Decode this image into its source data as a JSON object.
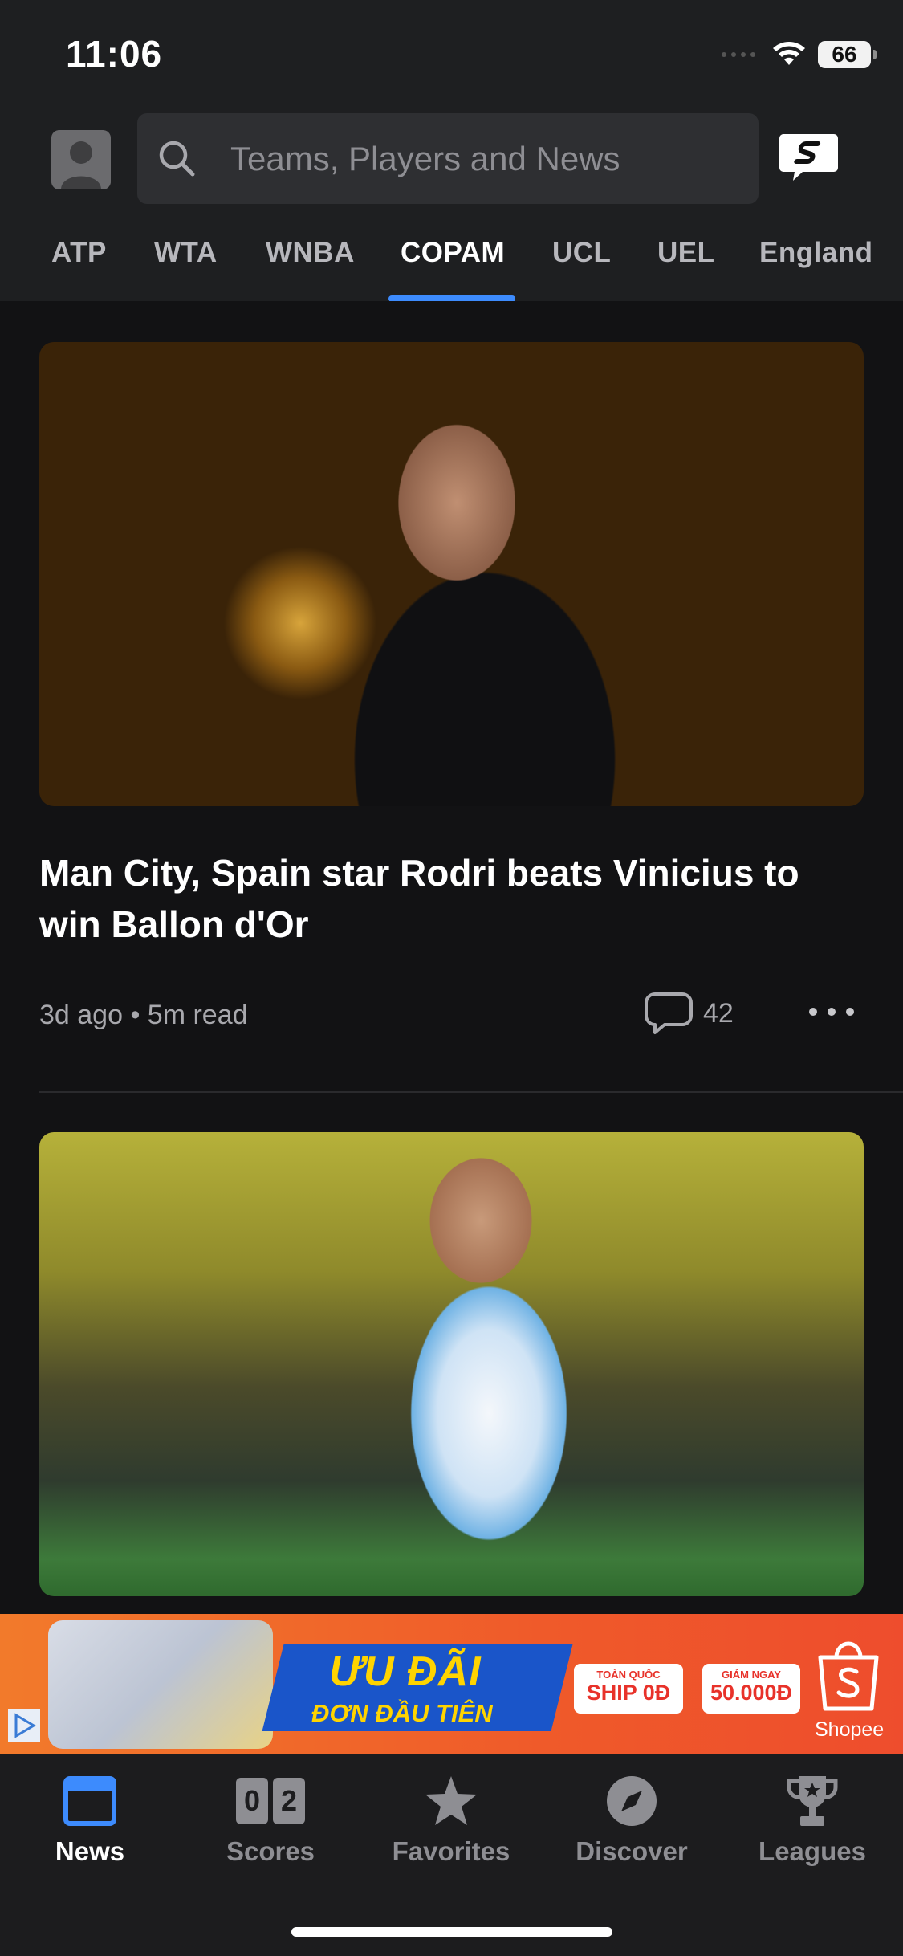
{
  "status_bar": {
    "time": "11:06",
    "battery": "66"
  },
  "header": {
    "search_placeholder": "Teams, Players and News",
    "tabs": [
      "ATP",
      "WTA",
      "WNBA",
      "COPAM",
      "UCL",
      "UEL",
      "England"
    ],
    "active_tab": "COPAM"
  },
  "articles": [
    {
      "headline": "Man City, Spain star Rodri beats Vinicius to win Ballon d'Or",
      "meta": "3d ago • 5m read",
      "comments": "42"
    },
    {
      "headline": ""
    }
  ],
  "ad": {
    "title": "ƯU ĐÃI",
    "subtitle": "ĐƠN ĐẦU TIÊN",
    "chip1_small": "TOÀN QUỐC",
    "chip1_big": "SHIP 0Đ",
    "chip2_small": "GIẢM NGAY",
    "chip2_big": "50.000Đ",
    "brand": "Shopee"
  },
  "tabbar": {
    "items": [
      "News",
      "Scores",
      "Favorites",
      "Discover",
      "Leagues"
    ],
    "active": "News",
    "score_digits": [
      "0",
      "2"
    ]
  },
  "colors": {
    "accent": "#3d8bfd",
    "background": "#121214",
    "header": "#1e1f21"
  }
}
